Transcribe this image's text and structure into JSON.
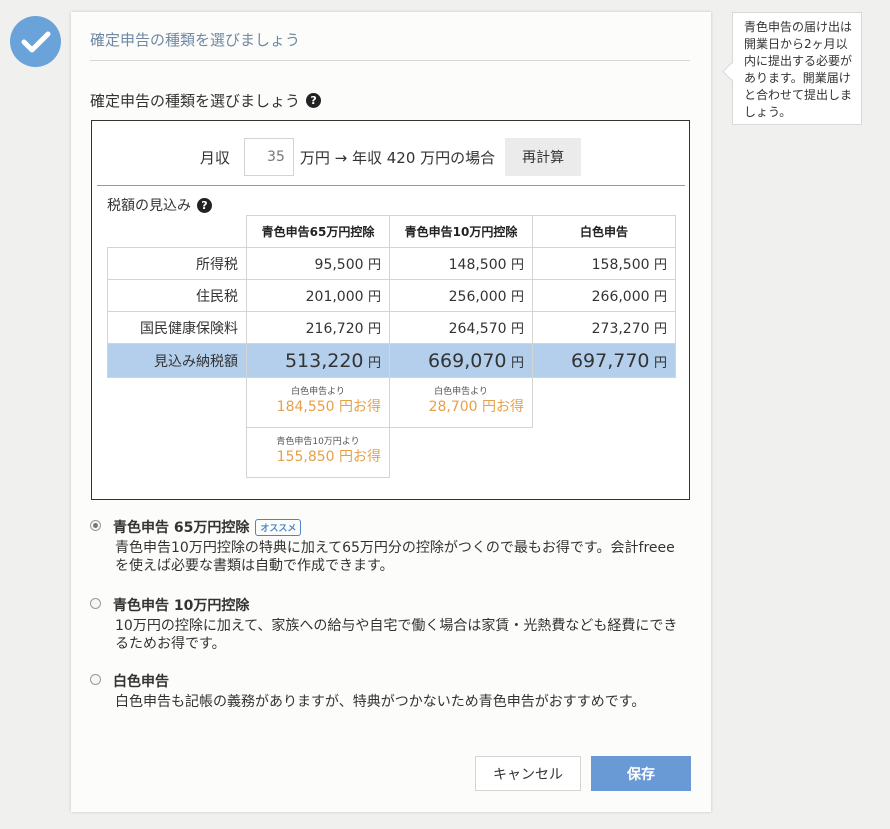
{
  "card": {
    "title": "確定申告の種類を選びましょう",
    "section_heading": "確定申告の種類を選びましょう",
    "help_glyph": "?"
  },
  "income": {
    "label": "月収",
    "value": "35",
    "text": "万円 → 年収 420 万円の場合",
    "recalc_label": "再計算"
  },
  "estimate": {
    "label": "税額の見込み",
    "columns": [
      "青色申告65万円控除",
      "青色申告10万円控除",
      "白色申告"
    ],
    "unit": "円",
    "rows": [
      {
        "label": "所得税",
        "values": [
          "95,500",
          "148,500",
          "158,500"
        ]
      },
      {
        "label": "住民税",
        "values": [
          "201,000",
          "256,000",
          "266,000"
        ]
      },
      {
        "label": "国民健康保険料",
        "values": [
          "216,720",
          "264,570",
          "273,270"
        ]
      }
    ],
    "total": {
      "label": "見込み納税額",
      "values": [
        "513,220",
        "669,070",
        "697,770"
      ]
    },
    "savings_vs_white": [
      {
        "label": "白色申告より",
        "amount": "184,550 円お得"
      },
      {
        "label": "白色申告より",
        "amount": "28,700 円お得"
      }
    ],
    "savings_vs_blue10": {
      "label": "青色申告10万円より",
      "amount": "155,850 円お得"
    }
  },
  "options": [
    {
      "title": "青色申告 65万円控除",
      "badge": "オススメ",
      "selected": true,
      "desc": "青色申告10万円控除の特典に加えて65万円分の控除がつくので最もお得です。会計freeeを使えば必要な書類は自動で作成できます。"
    },
    {
      "title": "青色申告 10万円控除",
      "badge": "",
      "selected": false,
      "desc": "10万円の控除に加えて、家族への給与や自宅で働く場合は家賃・光熱費なども経費にできるためお得です。"
    },
    {
      "title": "白色申告",
      "badge": "",
      "selected": false,
      "desc": "白色申告も記帳の義務がありますが、特典がつかないため青色申告がおすすめです。"
    }
  ],
  "buttons": {
    "cancel": "キャンセル",
    "save": "保存"
  },
  "tooltip": {
    "text": "青色申告の届け出は開業日から2ヶ月以内に提出する必要があります。開業届けと合わせて提出しましょう。"
  },
  "colors": {
    "accent": "#6a9ad6",
    "total_row": "#b4cfeb",
    "savings": "#e8a047",
    "title": "#6f89a5"
  }
}
